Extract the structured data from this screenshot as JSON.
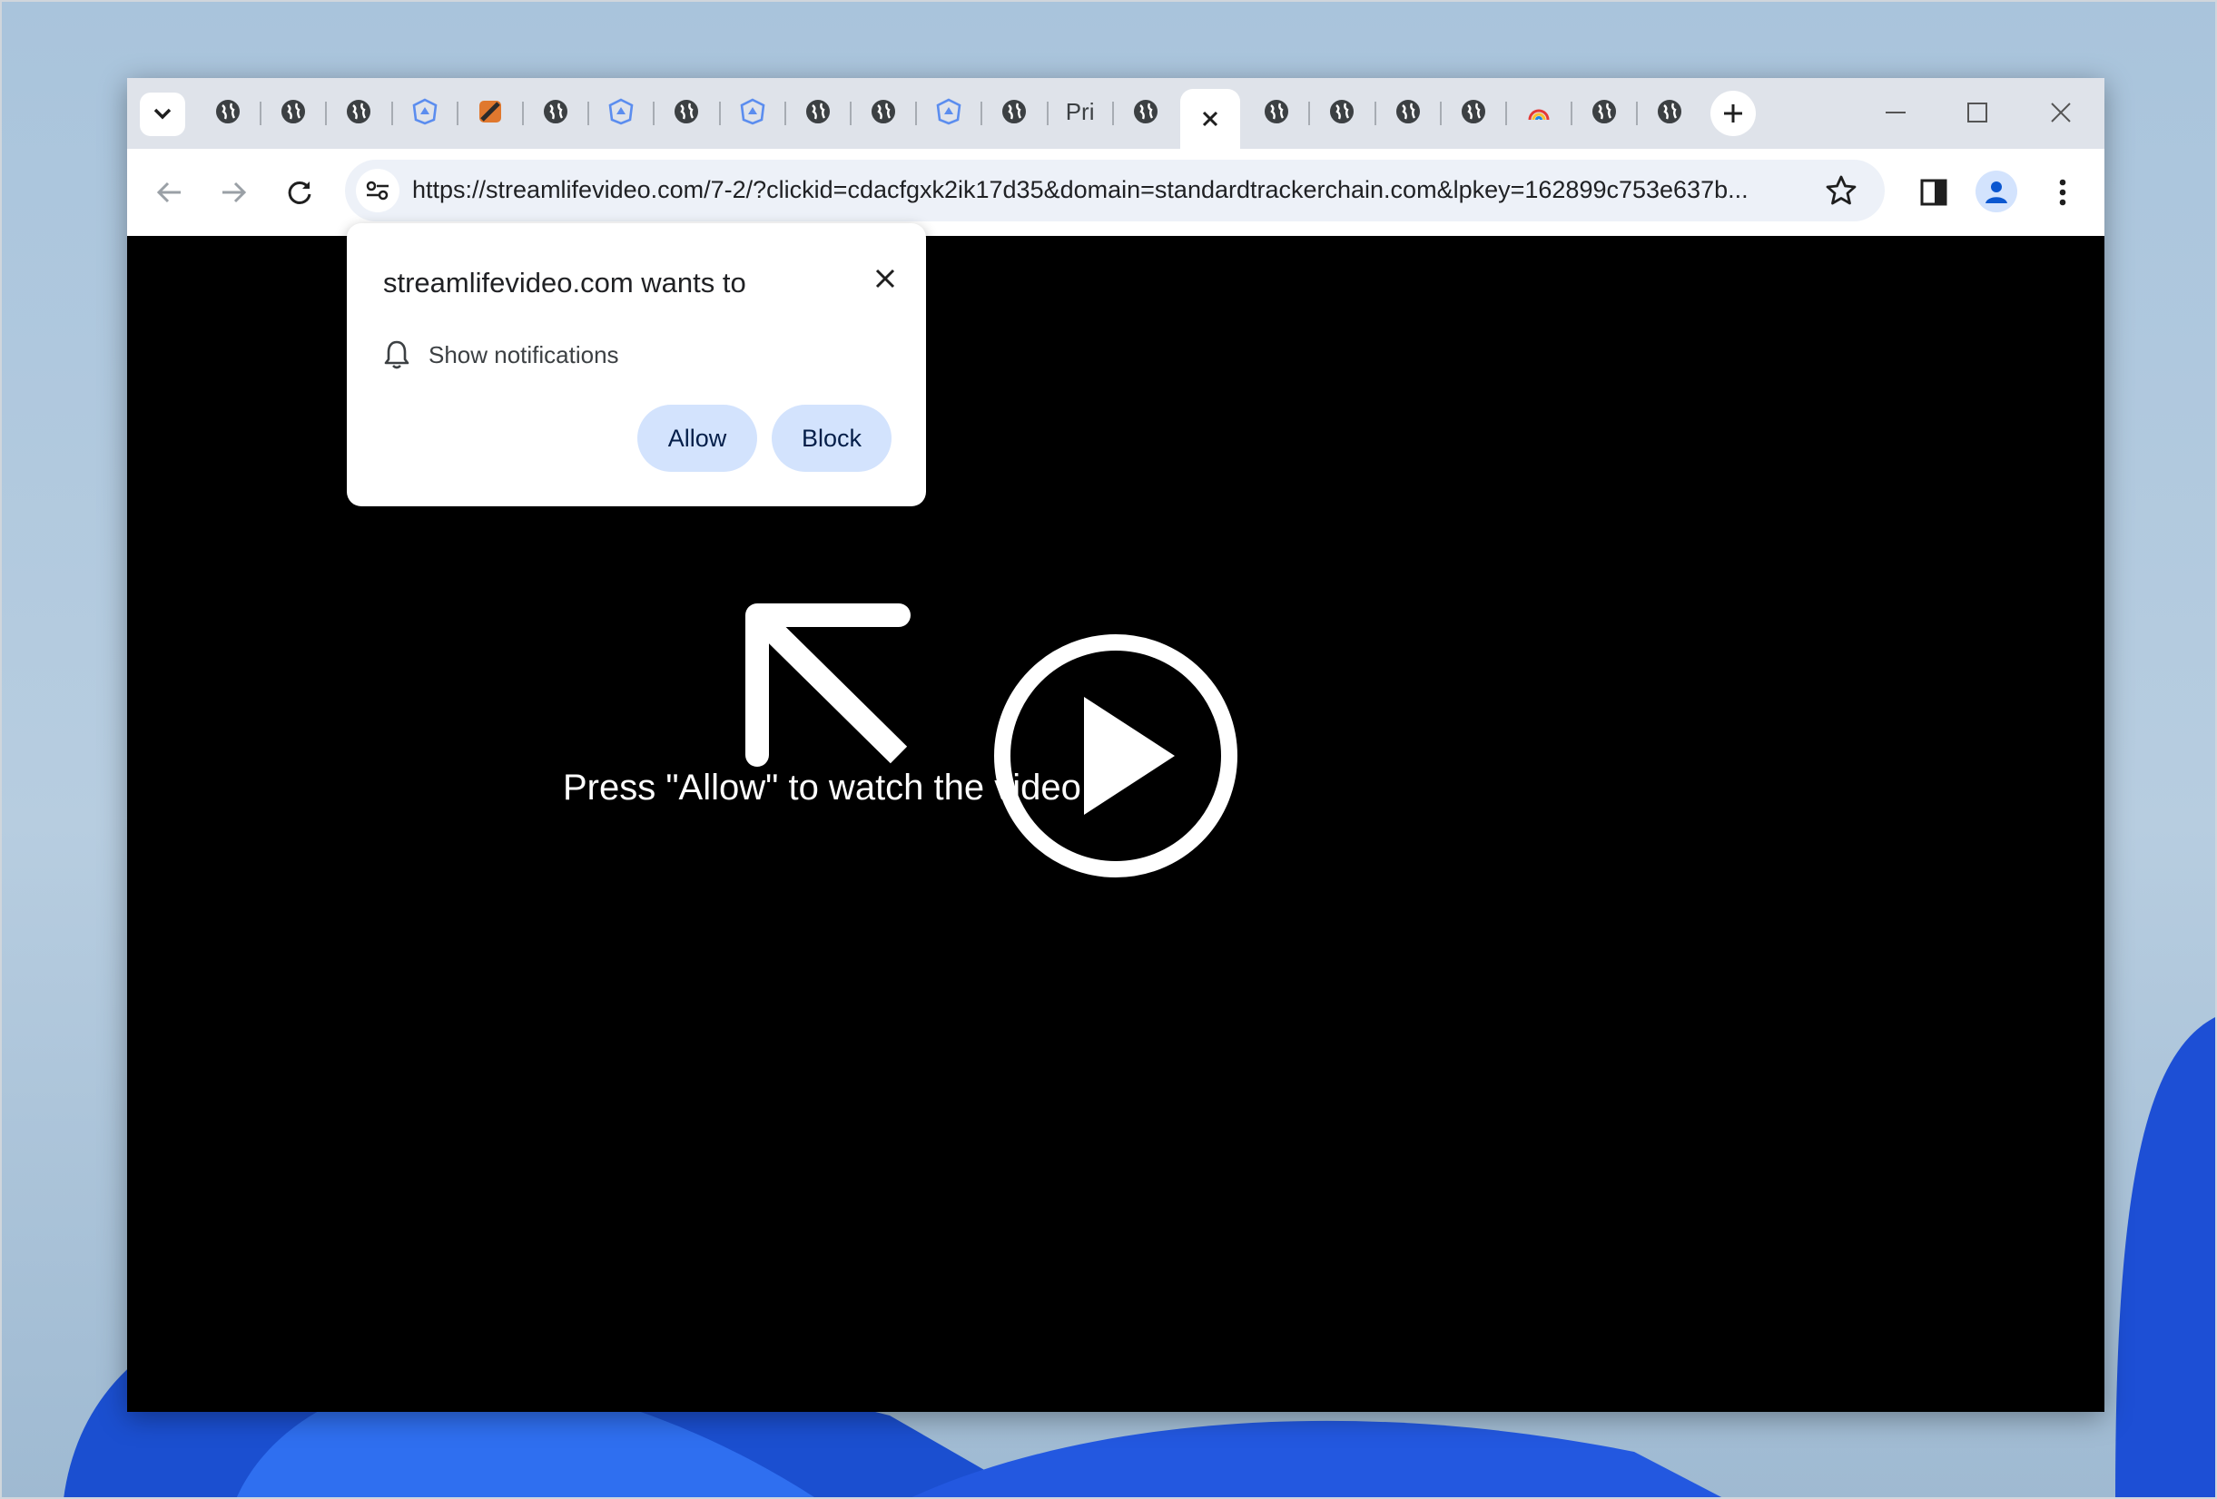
{
  "browser": {
    "tabs": [
      {
        "icon": "globe-icon"
      },
      {
        "icon": "globe-icon"
      },
      {
        "icon": "globe-icon"
      },
      {
        "icon": "shield-icon"
      },
      {
        "icon": "colorful-favicon-icon"
      },
      {
        "icon": "globe-icon"
      },
      {
        "icon": "shield-icon"
      },
      {
        "icon": "globe-icon"
      },
      {
        "icon": "shield-icon"
      },
      {
        "icon": "globe-icon"
      },
      {
        "icon": "globe-icon"
      },
      {
        "icon": "shield-icon"
      },
      {
        "icon": "globe-icon"
      },
      {
        "label": "Pri"
      },
      {
        "icon": "globe-icon"
      },
      {
        "active": true,
        "icon": "close-icon"
      },
      {
        "icon": "globe-icon"
      },
      {
        "icon": "globe-icon"
      },
      {
        "icon": "globe-icon"
      },
      {
        "icon": "globe-icon"
      },
      {
        "icon": "rainbow-icon"
      },
      {
        "icon": "globe-icon"
      },
      {
        "icon": "globe-icon"
      }
    ],
    "address_bar": {
      "url": "https://streamlifevideo.com/7-2/?clickid=cdacfgxk2ik17d35&domain=standardtrackerchain.com&lpkey=162899c753e637b..."
    }
  },
  "permission_popup": {
    "title": "streamlifevideo.com wants to",
    "permission": "Show notifications",
    "allow_label": "Allow",
    "block_label": "Block"
  },
  "page": {
    "overlay_text": "Press \"Allow\" to watch the video"
  },
  "colors": {
    "tabstrip": "#dfe3ea",
    "omnibox": "#edf1f8",
    "button": "#d3e3fd",
    "page_bg": "#000000"
  }
}
